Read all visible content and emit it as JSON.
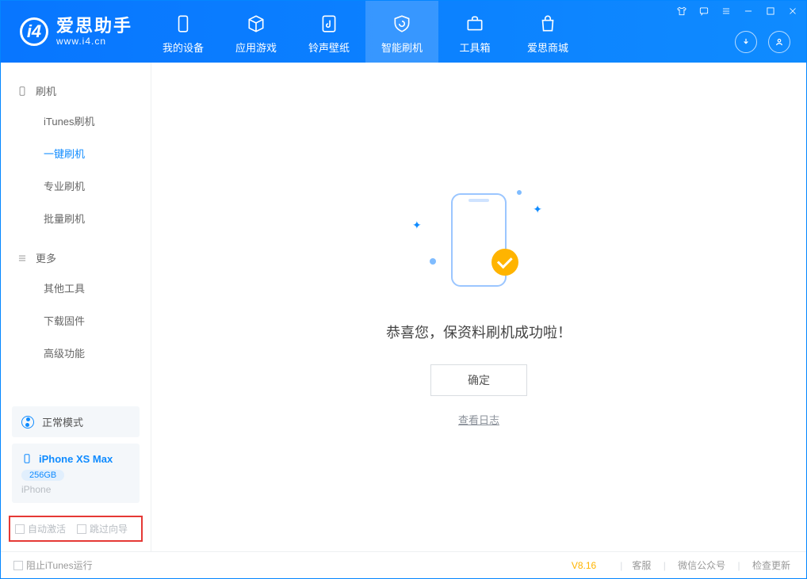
{
  "app": {
    "title": "爱思助手",
    "subtitle": "www.i4.cn"
  },
  "tabs": {
    "device": "我的设备",
    "apps": "应用游戏",
    "ring": "铃声壁纸",
    "flash": "智能刷机",
    "tools": "工具箱",
    "store": "爱思商城"
  },
  "sidebar": {
    "group_flash": "刷机",
    "items_flash": {
      "itunes": "iTunes刷机",
      "onekey": "一键刷机",
      "pro": "专业刷机",
      "batch": "批量刷机"
    },
    "group_more": "更多",
    "items_more": {
      "other": "其他工具",
      "firmware": "下载固件",
      "advanced": "高级功能"
    }
  },
  "mode": {
    "label": "正常模式"
  },
  "device": {
    "name": "iPhone XS Max",
    "storage": "256GB",
    "type": "iPhone"
  },
  "options": {
    "auto_activate": "自动激活",
    "skip_guide": "跳过向导"
  },
  "main": {
    "success": "恭喜您，保资料刷机成功啦！",
    "ok": "确定",
    "view_log": "查看日志"
  },
  "footer": {
    "block_itunes": "阻止iTunes运行",
    "version": "V8.16",
    "service": "客服",
    "wechat": "微信公众号",
    "update": "检查更新"
  }
}
